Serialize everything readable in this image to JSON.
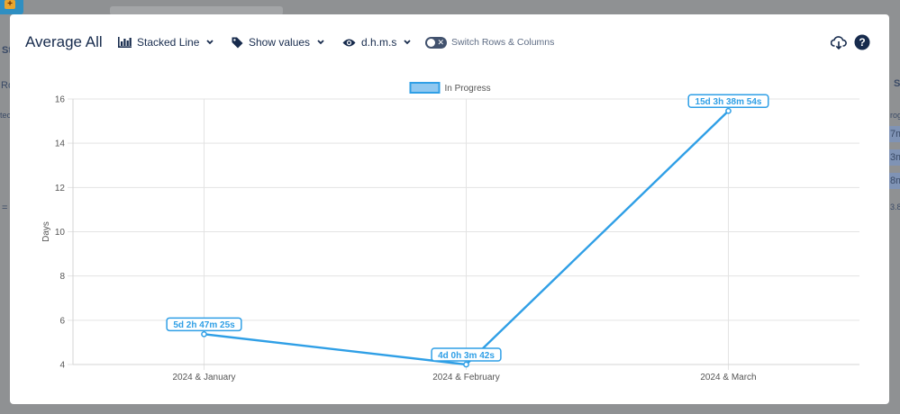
{
  "background": {
    "fragments_left": [
      "St",
      "Ro",
      "tec",
      "="
    ],
    "fragments_right": [
      "S",
      "rog",
      "7m",
      "3m",
      "8m",
      "3.8"
    ]
  },
  "modal": {
    "title": "Average All",
    "toolbar": {
      "chart_type": "Stacked Line",
      "show_values": "Show values",
      "format": "d.h.m.s",
      "switch_label": "Switch Rows & Columns",
      "switch_state": "off"
    }
  },
  "colors": {
    "accent": "#2f9fe6",
    "text_dark": "#172b4d",
    "legend_fill": "#90c8f0"
  },
  "chart_data": {
    "type": "line",
    "categories": [
      "2024 & January",
      "2024 & February",
      "2024 & March"
    ],
    "series": [
      {
        "name": "In Progress",
        "values": [
          5.37,
          4.0,
          15.46
        ],
        "labels": [
          "5d 2h 47m 25s",
          "4d 0h 3m 42s",
          "15d 3h 38m 54s"
        ]
      }
    ],
    "ylabel": "Days",
    "ylim": [
      4,
      16
    ],
    "yticks": [
      4,
      6,
      8,
      10,
      12,
      14,
      16
    ],
    "grid": true,
    "legend_position": "top"
  }
}
